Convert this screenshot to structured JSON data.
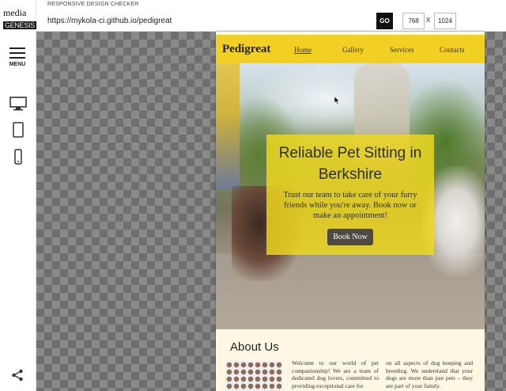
{
  "brand": {
    "line1": "media",
    "line2": "GENESIS"
  },
  "sidebar": {
    "menu_label": "MENU",
    "devices": [
      {
        "icon": "desktop-icon"
      },
      {
        "icon": "tablet-icon"
      },
      {
        "icon": "mobile-icon"
      }
    ],
    "share_icon": "share-icon"
  },
  "topbar": {
    "title": "RESPONSIVE DESIGN CHECKER",
    "url": "https://mykola-ci.github.io/pedigreat",
    "go_label": "GO",
    "width": "768",
    "separator": "X",
    "height": "1024"
  },
  "site": {
    "brand": "Pedigreat",
    "nav": [
      "Home",
      "Gallery",
      "Services",
      "Contacts"
    ],
    "active_nav": "Home",
    "hero": {
      "title": "Reliable Pet Sitting in Berkshire",
      "text": "Trust our team to take care of your furry friends while you're away. Book now or make an appointment!",
      "cta": "Book Now"
    },
    "about": {
      "title": "About Us",
      "col1": "Welcome to our world of pet companionship! We are a team of dedicated dog lovers, committed to providing exceptional care for",
      "col2": "on all aspects of dog keeping and breeding. We understand that your dogs are more than just pets – they are part of your family."
    }
  },
  "colors": {
    "nav_yellow": "#f2cf23",
    "hero_box": "#f0da1c",
    "button": "#4c4a43"
  }
}
